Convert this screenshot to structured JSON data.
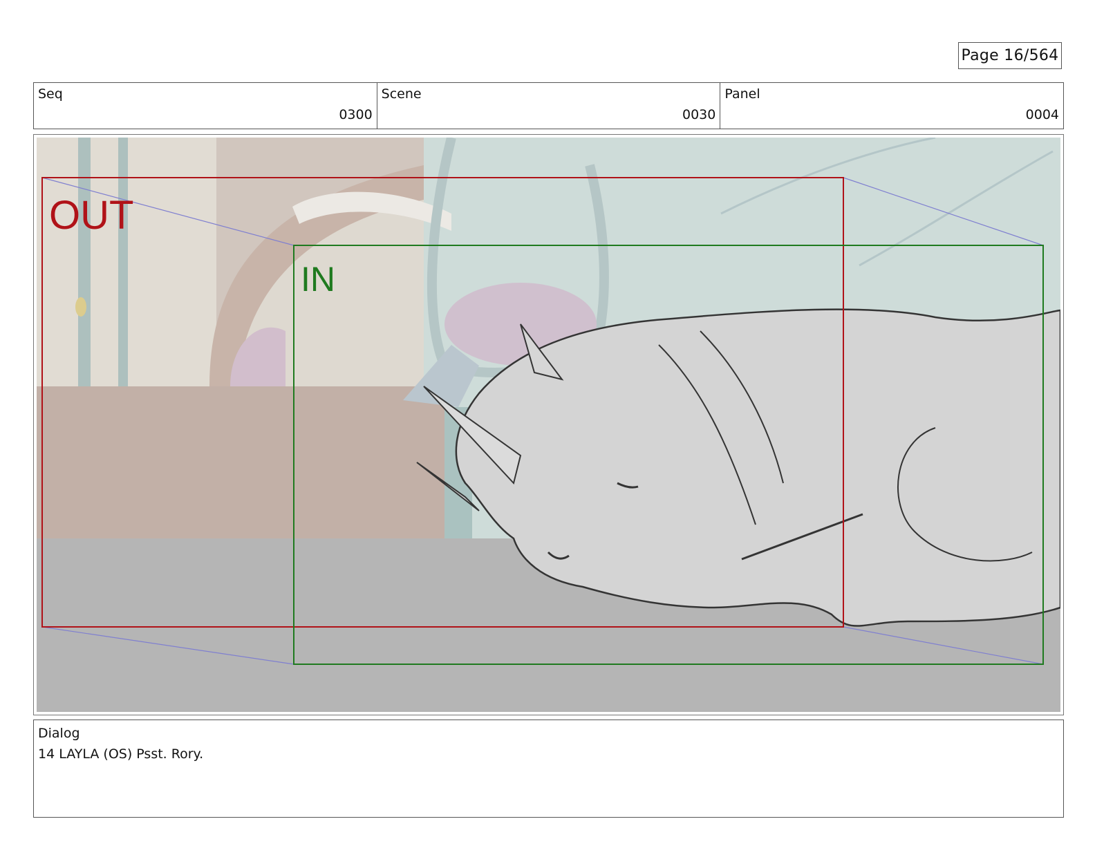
{
  "page": {
    "label": "Page 16/564"
  },
  "header": {
    "seq": {
      "label": "Seq",
      "value": "0300"
    },
    "scene": {
      "label": "Scene",
      "value": "0030"
    },
    "panel": {
      "label": "Panel",
      "value": "0004"
    }
  },
  "frame": {
    "out_label": "OUT",
    "in_label": "IN",
    "out_color": "#b01218",
    "in_color": "#1f7a1f"
  },
  "dialog": {
    "label": "Dialog",
    "text": "14 LAYLA (OS) Psst. Rory."
  }
}
